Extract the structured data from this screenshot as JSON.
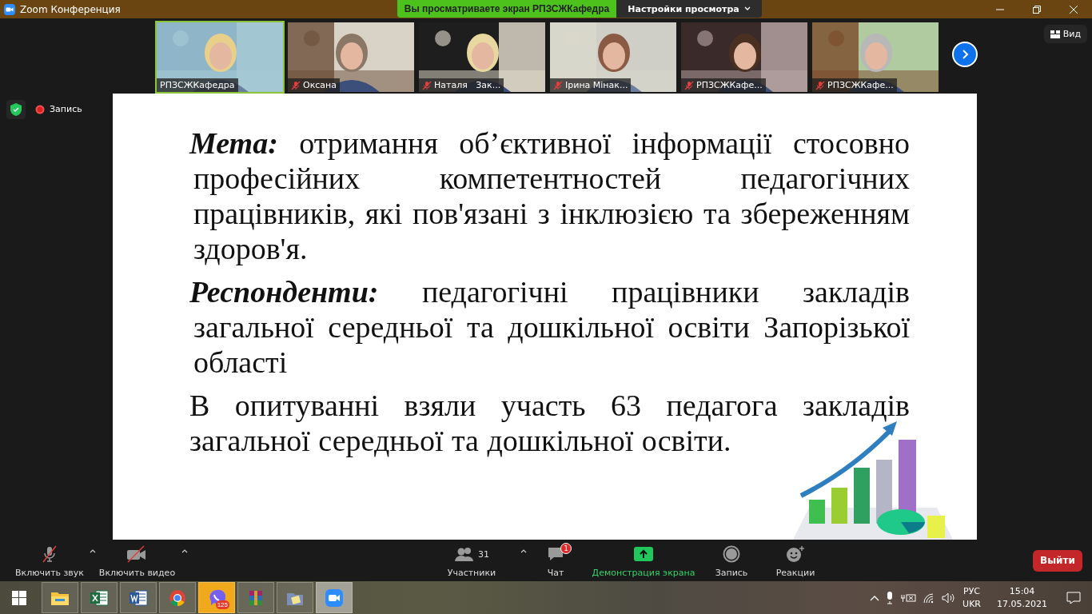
{
  "window": {
    "title": "Zoom Конференция"
  },
  "share_banner": {
    "text": "Вы просматриваете экран РПЗСЖКафедра",
    "view_options": "Настройки просмотра"
  },
  "participants": [
    {
      "name": "РПЗСЖКафедра",
      "muted": false,
      "selected": true
    },
    {
      "name": "Оксана",
      "muted": true,
      "selected": false
    },
    {
      "name": "Наталя   Зак...",
      "muted": true,
      "selected": false
    },
    {
      "name": "Ірина Мінак...",
      "muted": true,
      "selected": false
    },
    {
      "name": "РПЗСЖКафе...",
      "muted": true,
      "selected": false
    },
    {
      "name": "РПЗСЖКафе...",
      "muted": true,
      "selected": false
    }
  ],
  "view_button": "Вид",
  "recording_label": "Запись",
  "slide": {
    "paragraphs": [
      {
        "term": "Мета:",
        "text": "отримання об’єктивної інформації  стосовно професійних компетентностей педагогічних працівників, які пов'язані з інклюзією та збереженням здоров'я."
      },
      {
        "term": "Респонденти:",
        "text": "педагогічні працівники закладів загальної середньої та дошкільної освіти Запорізької області"
      },
      {
        "text": "В опитуванні взяли участь 63 педагога закладів загальної середньої та дошкільної освіти."
      }
    ]
  },
  "toolbar": [
    {
      "kind": "mic",
      "label": "Включить звук",
      "caret": true
    },
    {
      "kind": "video",
      "label": "Включить видео",
      "caret": true
    },
    {
      "kind": "participants",
      "label": "Участники",
      "count": "31",
      "caret": true
    },
    {
      "kind": "chat",
      "label": "Чат",
      "badge": "1"
    },
    {
      "kind": "share",
      "label": "Демонстрация экрана"
    },
    {
      "kind": "record",
      "label": "Запись"
    },
    {
      "kind": "reactions",
      "label": "Реакции"
    }
  ],
  "leave_button": "Выйти",
  "taskbar": {
    "apps": [
      {
        "kind": "explorer",
        "selected": false
      },
      {
        "kind": "excel",
        "selected": false
      },
      {
        "kind": "word",
        "selected": false
      },
      {
        "kind": "chrome",
        "selected": false
      },
      {
        "kind": "viber",
        "selected": false,
        "badge": "125"
      },
      {
        "kind": "winrar",
        "selected": false
      },
      {
        "kind": "folder",
        "selected": false
      },
      {
        "kind": "zoom",
        "selected": true
      }
    ],
    "language": "РУС",
    "layout": "UKR",
    "time": "15:04",
    "date": "17.05.2021"
  }
}
